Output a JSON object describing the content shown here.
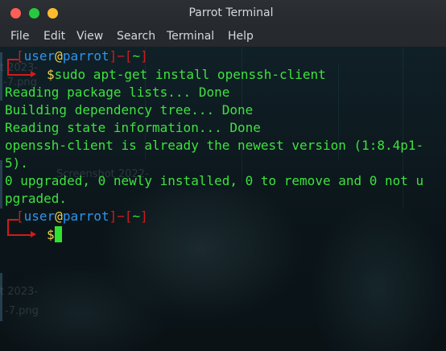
{
  "window": {
    "title": "Parrot Terminal"
  },
  "menu": {
    "items": [
      "File",
      "Edit",
      "View",
      "Search",
      "Terminal",
      "Help"
    ]
  },
  "colors": {
    "prompt_bracket": "#d21a1a",
    "prompt_user": "#2d95f0",
    "prompt_at": "#f0d44a",
    "output_text": "#3ee23e"
  },
  "prompt1": {
    "open": "[",
    "user": "user",
    "at": "@",
    "host": "parrot",
    "close": "]",
    "dash": "−",
    "path_open": "[",
    "path": "~",
    "path_close": "]",
    "dollar": "$",
    "command": "sudo apt-get install openssh-client"
  },
  "output": [
    "Reading package lists... Done",
    "Building dependency tree... Done",
    "Reading state information... Done",
    "openssh-client is already the newest version (1:8.4p1-",
    "5).",
    "0 upgraded, 0 newly installed, 0 to remove and 0 not u",
    "pgraded."
  ],
  "prompt2": {
    "open": "[",
    "user": "user",
    "at": "@",
    "host": "parrot",
    "close": "]",
    "dash": "−",
    "path_open": "[",
    "path": "~",
    "path_close": "]",
    "dollar": "$"
  },
  "background_labels": {
    "a": "2023-",
    "b": "-7.png",
    "c": "t 2023-",
    "d": "-7.png",
    "e": "Screenshot 2022-",
    "f": "t",
    "g": "t"
  }
}
